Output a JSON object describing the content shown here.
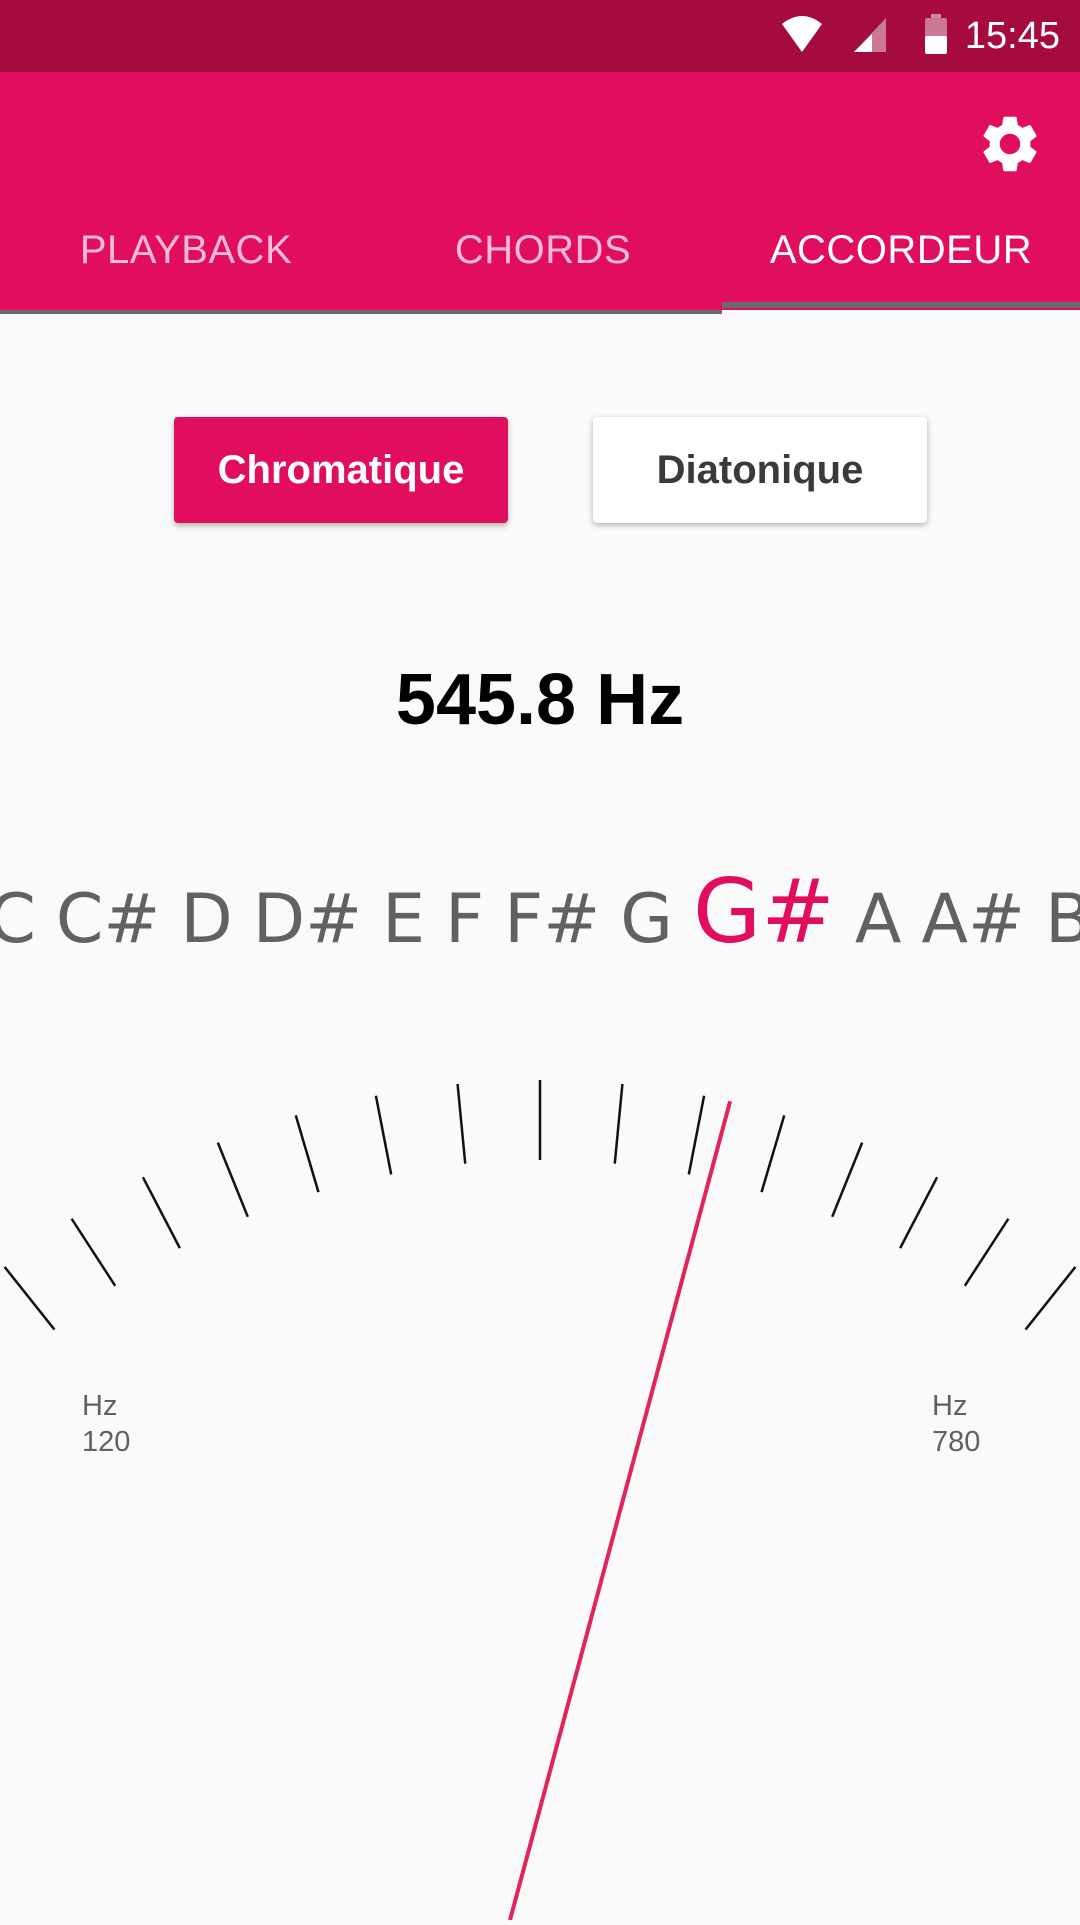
{
  "status_bar": {
    "time": "15:45",
    "icons": [
      "wifi-icon",
      "cell-signal-icon",
      "battery-icon"
    ]
  },
  "app_bar": {
    "settings_icon": "gear-icon",
    "tabs": [
      {
        "label": "PLAYBACK",
        "active": false
      },
      {
        "label": "CHORDS",
        "active": false
      },
      {
        "label": "ACCORDEUR",
        "active": true
      }
    ]
  },
  "modes": {
    "chromatic": "Chromatique",
    "diatonic": "Diatonique",
    "selected": "Chromatique"
  },
  "tuner": {
    "frequency": "545.8 Hz",
    "notes": [
      "C",
      "C#",
      "D",
      "D#",
      "E",
      "F",
      "F#",
      "G",
      "G#",
      "A",
      "A#",
      "B"
    ],
    "current_note": "G#",
    "min_unit": "Hz",
    "min_value": "120",
    "max_unit": "Hz",
    "max_value": "780",
    "min_hz": 120,
    "max_hz": 780,
    "needle_hz": 545.8
  },
  "colors": {
    "accent": "#e10d5f",
    "status_bar": "#a50b41",
    "needle": "#e1245a",
    "tick": "#111111"
  }
}
